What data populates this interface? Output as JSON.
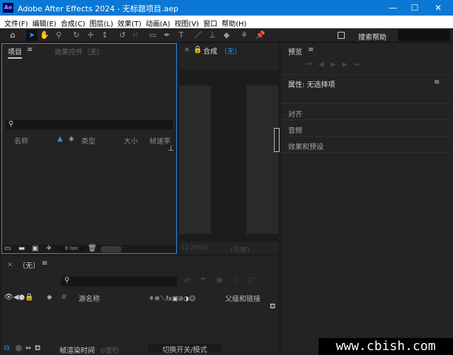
{
  "window": {
    "title": "Adobe After Effects 2024 - 无标题项目.aep",
    "logo": "Ae",
    "minimize": "—",
    "maximize": "☐",
    "close": "✕"
  },
  "menu": [
    "文件(F)",
    "编辑(E)",
    "合成(C)",
    "图层(L)",
    "效果(T)",
    "动画(A)",
    "视图(V)",
    "窗口",
    "帮助(H)"
  ],
  "toolbar": {
    "search_help": "搜索帮助",
    "icons": [
      "home-icon",
      "selection-arrow-icon",
      "hand-icon",
      "zoom-icon",
      "orbit-camera-icon",
      "pan-camera-icon",
      "dolly-camera-icon",
      "rotate-icon",
      "anchor-icon",
      "rectangle-icon",
      "pen-icon",
      "text-icon",
      "brush-icon",
      "clone-stamp-icon",
      "eraser-icon",
      "roto-brush-icon",
      "puppet-pin-icon"
    ]
  },
  "project_panel": {
    "tab_project": "项目",
    "tab_effects": "效果控件（无）",
    "columns": [
      "名称",
      "类型",
      "大小",
      "帧速率"
    ],
    "bpc": "8 bpc"
  },
  "comp_panel": {
    "tab": "合成",
    "tab_value": "（无）",
    "zoom": "(100%)",
    "resolution": "(完整)"
  },
  "right_panel": {
    "preview": "预览",
    "properties": "属性: 无选择项",
    "align": "对齐",
    "audio": "音频",
    "effects_presets": "效果和预设"
  },
  "timeline": {
    "tab": "（无）",
    "columns": [
      "源名称",
      "父级和链接"
    ],
    "render_time_label": "帧渲染时间",
    "render_time_value": "0毫秒",
    "toggle": "切换开关/模式"
  },
  "watermark": "www.cbish.com",
  "colors": {
    "accent": "#2d8ceb",
    "titlebar": "#0a78d4"
  }
}
